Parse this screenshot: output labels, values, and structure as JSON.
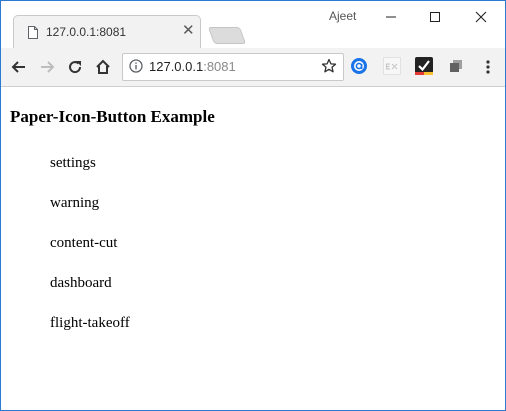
{
  "browser": {
    "tab_title": "127.0.0.1:8081",
    "user_name": "Ajeet",
    "url_host": "127.0.0.1",
    "url_port": ":8081"
  },
  "page": {
    "title": "Paper-Icon-Button Example",
    "items": [
      {
        "label": "settings"
      },
      {
        "label": "warning"
      },
      {
        "label": "content-cut"
      },
      {
        "label": "dashboard"
      },
      {
        "label": "flight-takeoff"
      }
    ]
  },
  "colors": {
    "window_border": "#2b79d0",
    "toolbar_bg": "#f2f2f2",
    "ext_blue": "#1a73e8"
  },
  "icons": {
    "tab_favicon": "page-icon",
    "tab_close": "close-icon",
    "back": "arrow-left-icon",
    "forward": "arrow-right-icon",
    "reload": "reload-icon",
    "home": "home-icon",
    "info": "info-icon",
    "star": "star-icon",
    "menu": "kebab-menu-icon"
  }
}
